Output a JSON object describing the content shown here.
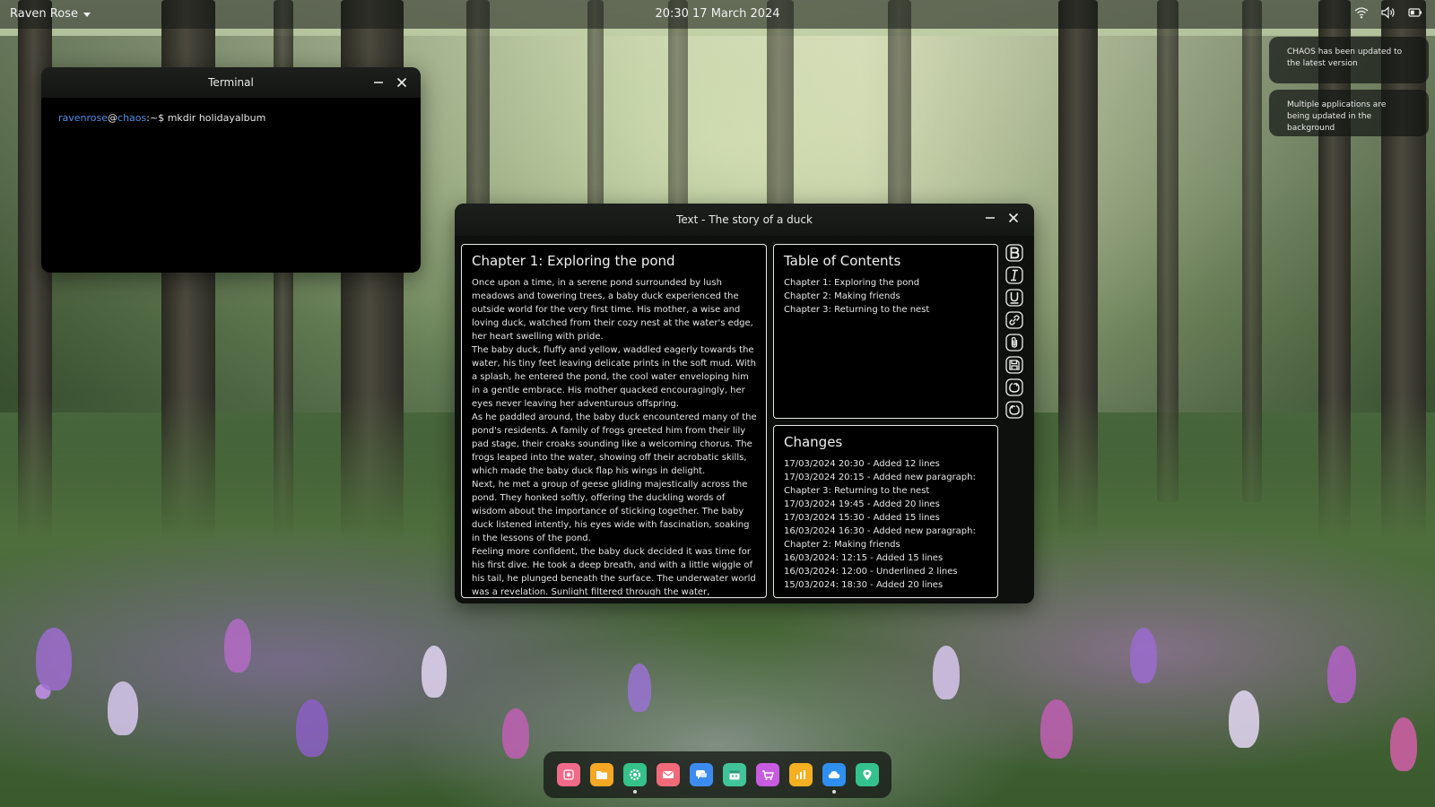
{
  "topbar": {
    "user_name": "Raven Rose",
    "datetime": "20:30 17 March 2024",
    "tray_icons": [
      "wifi-icon",
      "volume-icon",
      "battery-icon"
    ]
  },
  "notifications": [
    {
      "text": "CHAOS has been updated to the latest version"
    },
    {
      "text": "Multiple applications are being updated in the background"
    }
  ],
  "terminal": {
    "title": "Terminal",
    "user": "ravenrose",
    "at": "@",
    "host": "chaos",
    "prompt_suffix": ":~$ ",
    "command": "mkdir holidayalbum"
  },
  "editor": {
    "title": "Text - The story of a duck",
    "chapter_title": "Chapter 1: Exploring the pond",
    "paragraphs": [
      "Once upon a time, in a serene pond surrounded by lush meadows and towering trees, a baby duck experienced the outside world for the very first time. His mother, a wise and loving duck, watched from their cozy nest at the water's edge, her heart swelling with pride.",
      "The baby duck, fluffy and yellow, waddled eagerly towards the water, his tiny feet leaving delicate prints in the soft mud. With a splash, he entered the pond, the cool water enveloping him in a gentle embrace. His mother quacked encouragingly, her eyes never leaving her adventurous offspring.",
      "As he paddled around, the baby duck encountered many of the pond's residents. A family of frogs greeted him from their lily pad stage, their croaks sounding like a welcoming chorus. The frogs leaped into the water, showing off their acrobatic skills, which made the baby duck flap his wings in delight.",
      "Next, he met a group of geese gliding majestically across the pond. They honked softly, offering the duckling words of wisdom about the importance of sticking together. The baby duck listened intently, his eyes wide with fascination, soaking in the lessons of the pond.",
      "Feeling more confident, the baby duck decided it was time for his first dive. He took a deep breath, and with a little wiggle of his tail, he plunged beneath the surface. The underwater world was a revelation. Sunlight filtered through the water,"
    ],
    "toc": {
      "heading": "Table of Contents",
      "items": [
        "Chapter 1: Exploring the pond",
        "Chapter 2: Making friends",
        "Chapter 3: Returning to the nest"
      ]
    },
    "changes": {
      "heading": "Changes",
      "items": [
        "17/03/2024 20:30 - Added 12 lines",
        "17/03/2024 20:15 - Added new paragraph:",
        "Chapter 3: Returning to the nest",
        "17/03/2024 19:45 - Added 20 lines",
        "17/03/2024 15:30 - Added 15 lines",
        "16/03/2024 16:30 - Added new paragraph:",
        "Chapter 2: Making friends",
        "16/03/2024: 12:15 - Added 15 lines",
        "16/03/2024: 12:00 - Underlined 2 lines",
        "15/03/2024: 18:30 - Added 20 lines"
      ]
    },
    "toolbar_icons": [
      "bold-icon",
      "italic-icon",
      "underline-icon",
      "link-icon",
      "attach-icon",
      "save-icon",
      "undo-icon",
      "redo-icon"
    ]
  },
  "dock": {
    "apps": [
      {
        "icon": "photos-icon",
        "color": "#f06a8a",
        "running": false
      },
      {
        "icon": "files-icon",
        "color": "#f4a823",
        "running": false
      },
      {
        "icon": "settings-icon",
        "color": "#34c28a",
        "running": true
      },
      {
        "icon": "mail-icon",
        "color": "#f06a7a",
        "running": false
      },
      {
        "icon": "messages-icon",
        "color": "#3c8cf0",
        "running": false
      },
      {
        "icon": "calendar-icon",
        "color": "#42c49a",
        "running": false
      },
      {
        "icon": "store-icon",
        "color": "#c75ce0",
        "running": false
      },
      {
        "icon": "charts-icon",
        "color": "#f4b020",
        "running": false
      },
      {
        "icon": "cloud-icon",
        "color": "#2f8ff0",
        "running": true
      },
      {
        "icon": "maps-icon",
        "color": "#33c28e",
        "running": false
      }
    ]
  }
}
